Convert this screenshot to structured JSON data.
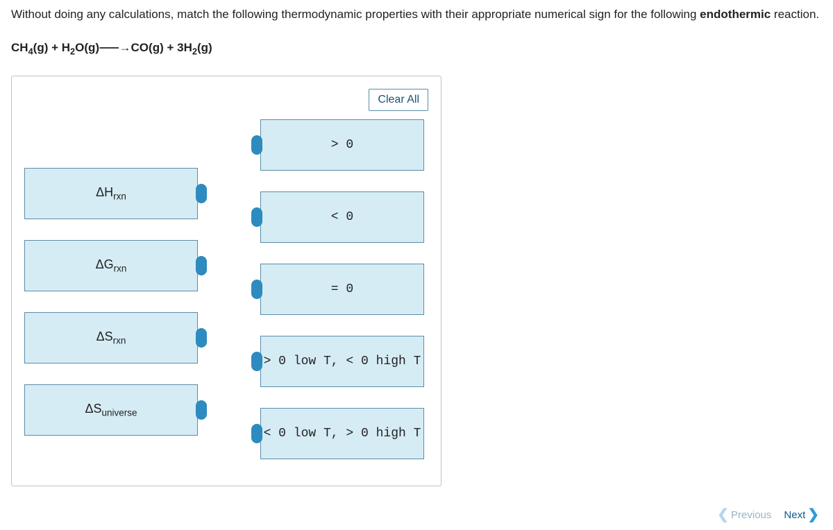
{
  "question": {
    "prefix": "Without doing any calculations, match the following thermodynamic properties with their appropriate numerical sign for the following ",
    "bold": "endothermic",
    "suffix": " reaction."
  },
  "reaction": {
    "html": "CH<sub>4</sub>(g) + H<sub>2</sub>O(g)⸺→CO(g) + 3H<sub>2</sub>(g)"
  },
  "clear_all_label": "Clear All",
  "draggables": [
    {
      "html": "ΔH<sub>rxn</sub>"
    },
    {
      "html": "ΔG<sub>rxn</sub>"
    },
    {
      "html": "ΔS<sub>rxn</sub>"
    },
    {
      "html": "ΔS<sub>universe</sub>"
    }
  ],
  "targets": [
    {
      "label": "> 0"
    },
    {
      "label": "< 0"
    },
    {
      "label": "= 0"
    },
    {
      "label": "> 0 low T, < 0 high T"
    },
    {
      "label": "< 0 low T, > 0 high T"
    }
  ],
  "nav": {
    "previous": "Previous",
    "next": "Next"
  }
}
